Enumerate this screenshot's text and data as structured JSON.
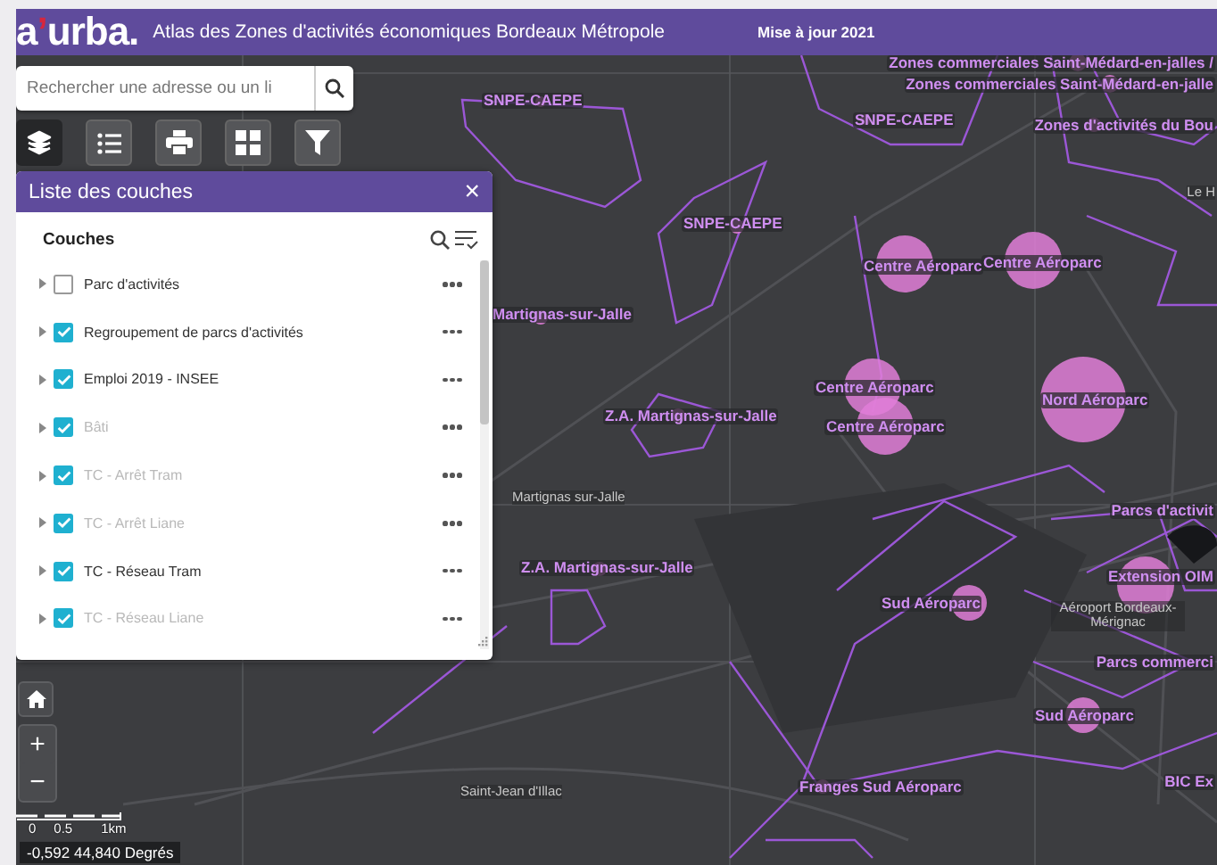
{
  "header": {
    "logo": {
      "prefix": "a",
      "mark": "’",
      "suffix": "urba."
    },
    "title": "Atlas des Zones d'activités économiques Bordeaux Métropole",
    "update": "Mise à jour 2021"
  },
  "search": {
    "placeholder": "Rechercher une adresse ou un li"
  },
  "toolbar": [
    {
      "kind": "layers",
      "selected": true
    },
    {
      "kind": "legend",
      "selected": false
    },
    {
      "kind": "print",
      "selected": false
    },
    {
      "kind": "grid",
      "selected": false
    },
    {
      "kind": "filter",
      "selected": false
    }
  ],
  "layer_panel": {
    "title": "Liste des couches",
    "close": "×",
    "heading": "Couches",
    "layers": [
      {
        "name": "Parc d'activités",
        "checked": false,
        "disabled": false
      },
      {
        "name": "Regroupement de parcs d'activités",
        "checked": true,
        "disabled": false
      },
      {
        "name": "Emploi 2019 - INSEE",
        "checked": true,
        "disabled": false
      },
      {
        "name": "Bâti",
        "checked": true,
        "disabled": true
      },
      {
        "name": "TC - Arrêt Tram",
        "checked": true,
        "disabled": true
      },
      {
        "name": "TC - Arrêt Liane",
        "checked": true,
        "disabled": true
      },
      {
        "name": "TC - Réseau Tram",
        "checked": true,
        "disabled": false
      },
      {
        "name": "TC - Réseau Liane",
        "checked": true,
        "disabled": true
      }
    ]
  },
  "map_labels": [
    {
      "kind": "zone",
      "text": "Zones commerciales Saint-Médard-en-jalles /"
    },
    {
      "kind": "zone",
      "text": "Zones commerciales Saint-Médard-en-jalle"
    },
    {
      "kind": "zone",
      "text": "SNPE-CAEPE"
    },
    {
      "kind": "zone",
      "text": "SNPE-CAEPE"
    },
    {
      "kind": "zone",
      "text": "Zones d'activités du Bou"
    },
    {
      "kind": "place",
      "text": "Le H"
    },
    {
      "kind": "zone",
      "text": "SNPE-CAEPE"
    },
    {
      "kind": "zone",
      "text": "Centre Aéroparc"
    },
    {
      "kind": "zone",
      "text": "Centre Aéroparc"
    },
    {
      "kind": "zone",
      "text": "Martignas-sur-Jalle"
    },
    {
      "kind": "zone",
      "text": "Centre Aéroparc"
    },
    {
      "kind": "zone",
      "text": "Nord Aéroparc"
    },
    {
      "kind": "zone",
      "text": "Z.A. Martignas-sur-Jalle"
    },
    {
      "kind": "zone",
      "text": "Centre Aéroparc"
    },
    {
      "kind": "place",
      "text": "Martignas sur-Jalle"
    },
    {
      "kind": "zone",
      "text": "Parcs d'activit"
    },
    {
      "kind": "zone",
      "text": "Z.A. Martignas-sur-Jalle"
    },
    {
      "kind": "zone",
      "text": "Extension OIM"
    },
    {
      "kind": "zone",
      "text": "Sud Aéroparc"
    },
    {
      "kind": "place",
      "text": "Aéroport Bordeaux-Mérignac"
    },
    {
      "kind": "zone",
      "text": "Parcs commerci"
    },
    {
      "kind": "zone",
      "text": "Sud Aéroparc"
    },
    {
      "kind": "zone",
      "text": "Franges Sud Aéroparc"
    },
    {
      "kind": "zone",
      "text": "BIC Ex"
    },
    {
      "kind": "place",
      "text": "Saint-Jean d'Illac"
    }
  ],
  "zoom": {
    "in": "+",
    "out": "−"
  },
  "scale": [
    "0",
    "0.5",
    "1km"
  ],
  "coordinates": "-0,592 44,840 Degrés"
}
